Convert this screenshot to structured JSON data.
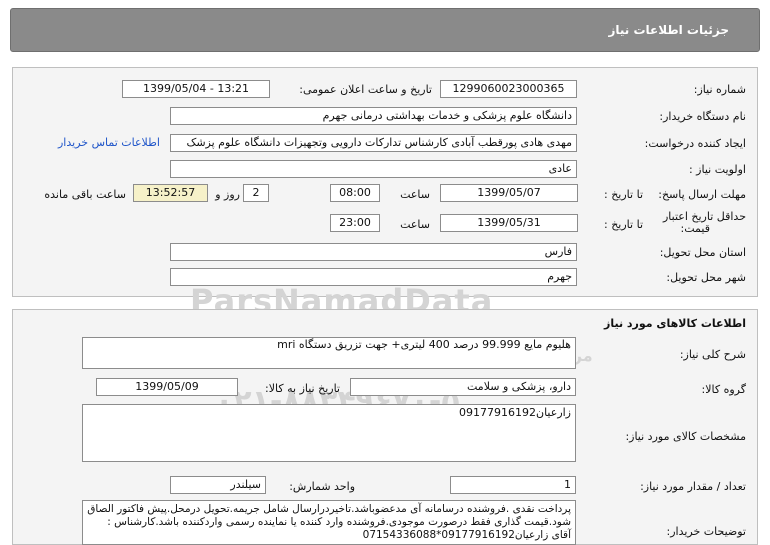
{
  "header": {
    "title": "جزئیات اطلاعات نیاز"
  },
  "info": {
    "need_number_label": "شماره نیاز:",
    "need_number": "1299060023000365",
    "announce_label": "تاریخ و ساعت اعلان عمومی:",
    "announce_value": "1399/05/04 - 13:21",
    "buyer_label": "نام دستگاه خریدار:",
    "buyer_value": "دانشگاه علوم پزشکی و خدمات بهداشتی درمانی جهرم",
    "creator_label": "ایجاد کننده درخواست:",
    "creator_value": "مهدی هادی پورقطب آبادی کارشناس تدارکات دارویی وتجهیزات دانشگاه علوم پزشک",
    "contact_link": "اطلاعات تماس خریدار",
    "priority_label": "اولویت نیاز :",
    "priority_value": "عادی",
    "deadline_label": "مهلت ارسال پاسخ:",
    "to_date_label": "تا تاریخ :",
    "deadline_date": "1399/05/07",
    "time_label": "ساعت",
    "deadline_time": "08:00",
    "days_value": "2",
    "days_label": "روز و",
    "remaining_value": "13:52:57",
    "remaining_label": "ساعت باقی مانده",
    "validity_label_1": "حداقل تاریخ اعتبار",
    "validity_label_2": "قیمت:",
    "validity_date": "1399/05/31",
    "validity_time": "23:00",
    "province_label": "استان محل تحویل:",
    "province_value": "فارس",
    "city_label": "شهر محل تحویل:",
    "city_value": "جهرم"
  },
  "watermark": {
    "brand": "ParsNamadData",
    "tagline": "مرکز فرآوری و ارائه اطلاعات پارس نماد داده ها",
    "phone": "۰۲۱-۸۸۳۴۹۶۷۰-۵"
  },
  "goods": {
    "title": "اطلاعات کالاهای مورد نیاز",
    "desc_label": "شرح کلی نیاز:",
    "desc_value": "هلیوم مایع 99.999 درصد 400 لیتری+ جهت تزریق دستگاه mri",
    "group_label": "گروه کالا:",
    "group_value": "دارو، پزشکی و سلامت",
    "need_date_label": "تاریخ نیاز به کالا:",
    "need_date": "1399/05/09",
    "spec_label": "مشخصات کالای مورد نیاز:",
    "spec_value": "زارعیان09177916192",
    "qty_label": "تعداد / مقدار مورد نیاز:",
    "qty_value": "1",
    "unit_label": "واحد شمارش:",
    "unit_value": "سیلندر",
    "buyer_notes_label": "توضیحات خریدار:",
    "buyer_notes": "پرداخت نقدی .فروشنده درسامانه آی مدعضوباشد.تاخیردرارسال شامل جریمه.تحویل درمحل.پیش فاکتور الصاق شود.قیمت گذاری فقط درصورت موجودی.فروشنده وارد کننده یا نماینده رسمی واردکننده باشد.کارشناس : آقای زارعیان09177916192*07154336088"
  }
}
